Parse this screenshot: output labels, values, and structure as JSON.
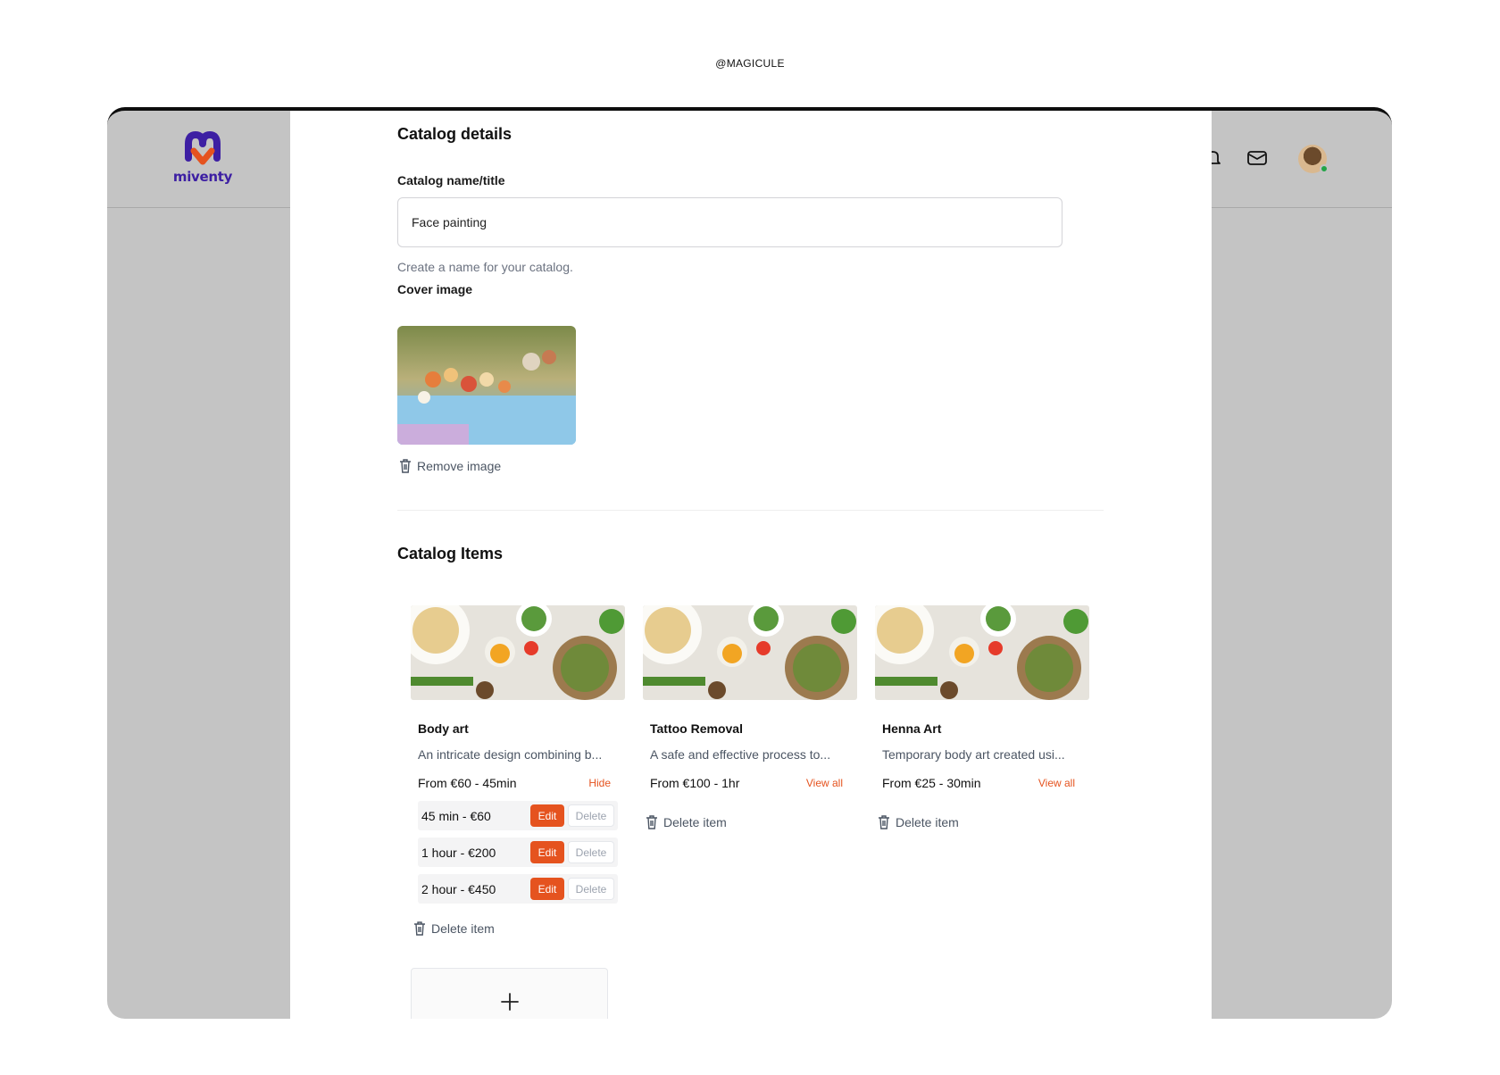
{
  "credit": "@MAGICULE",
  "brand": {
    "name": "miventy",
    "primary": "#3d1fa3",
    "accent": "#e5531f"
  },
  "topbar": {
    "icons": [
      "bell-icon",
      "mail-icon"
    ],
    "avatar_status": "online"
  },
  "catalog_details": {
    "heading": "Catalog details",
    "name_label": "Catalog name/title",
    "name_value": "Face painting",
    "name_hint": "Create a name for your catalog.",
    "cover_label": "Cover image",
    "remove_image": "Remove image"
  },
  "catalog_items": {
    "heading": "Catalog Items",
    "items": [
      {
        "title": "Body art",
        "description": "An intricate design combining b...",
        "price": "From €60 - 45min",
        "link": "Hide",
        "options": [
          {
            "label": "45 min - €60",
            "edit": "Edit",
            "delete": "Delete"
          },
          {
            "label": "1 hour - €200",
            "edit": "Edit",
            "delete": "Delete"
          },
          {
            "label": "2 hour - €450",
            "edit": "Edit",
            "delete": "Delete"
          }
        ],
        "delete_item": "Delete item"
      },
      {
        "title": "Tattoo Removal",
        "description": "A safe and effective process to...",
        "price": "From €100 - 1hr",
        "link": "View all",
        "delete_item": "Delete item"
      },
      {
        "title": "Henna Art",
        "description": "Temporary body art created usi...",
        "price": "From €25 - 30min",
        "link": "View all",
        "delete_item": "Delete item"
      }
    ],
    "add_label": "+"
  }
}
